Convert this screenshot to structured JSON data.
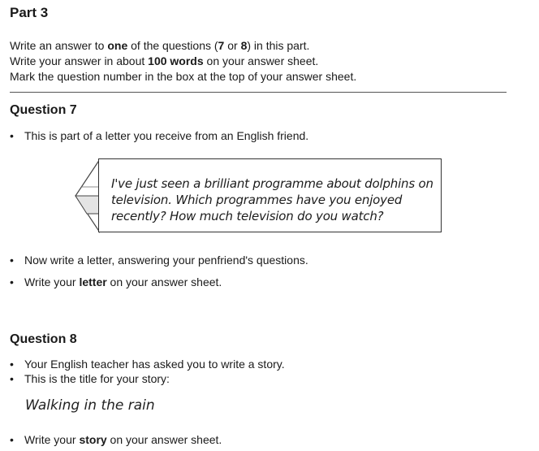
{
  "part": {
    "title": "Part 3"
  },
  "instructions": {
    "line1_pre": "Write an answer to ",
    "line1_bold1": "one",
    "line1_mid": " of the questions (",
    "line1_bold2": "7",
    "line1_or": " or ",
    "line1_bold3": "8",
    "line1_post": ") in this part.",
    "line2_pre": "Write your answer in about ",
    "line2_bold": "100 words",
    "line2_post": " on your answer sheet.",
    "line3": "Mark the question number in the box at the top of your answer sheet."
  },
  "question7": {
    "title": "Question 7",
    "bullet1": "This is part of a letter you receive from an English friend.",
    "letter_line1": "I've just seen a brilliant programme about dolphins on",
    "letter_line2": "television. Which programmes have you enjoyed",
    "letter_line3": "recently? How much television do you watch?",
    "bullet2": "Now write a letter, answering your penfriend's questions.",
    "bullet3_pre": "Write your ",
    "bullet3_bold": "letter",
    "bullet3_post": " on your answer sheet."
  },
  "question8": {
    "title": "Question 8",
    "bullet1": "Your English teacher has asked you to write a story.",
    "bullet2": "This is the title for your story:",
    "story_title": "Walking in the rain",
    "bullet3_pre": "Write your ",
    "bullet3_bold": "story",
    "bullet3_post": " on your answer sheet."
  },
  "icons": {
    "bullet": "•",
    "letter_fold": "folded-paper-icon"
  },
  "colors": {
    "text": "#1a1a1a",
    "rule": "#555555"
  }
}
